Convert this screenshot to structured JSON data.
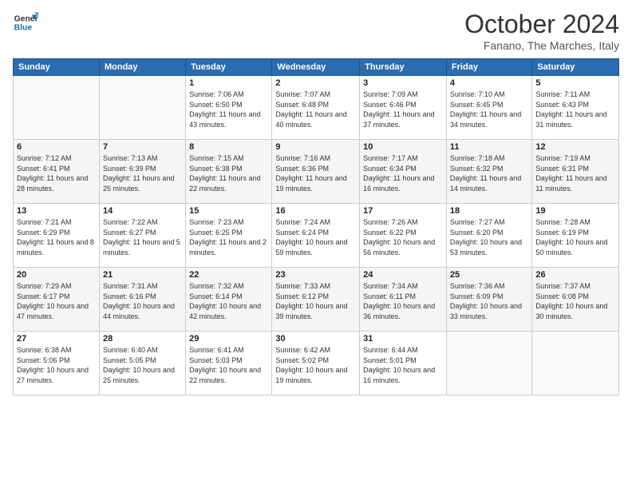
{
  "logo": {
    "line1": "General",
    "line2": "Blue"
  },
  "title": "October 2024",
  "subtitle": "Fanano, The Marches, Italy",
  "headers": [
    "Sunday",
    "Monday",
    "Tuesday",
    "Wednesday",
    "Thursday",
    "Friday",
    "Saturday"
  ],
  "weeks": [
    [
      {
        "day": "",
        "info": ""
      },
      {
        "day": "",
        "info": ""
      },
      {
        "day": "1",
        "info": "Sunrise: 7:06 AM\nSunset: 6:50 PM\nDaylight: 11 hours and 43 minutes."
      },
      {
        "day": "2",
        "info": "Sunrise: 7:07 AM\nSunset: 6:48 PM\nDaylight: 11 hours and 40 minutes."
      },
      {
        "day": "3",
        "info": "Sunrise: 7:09 AM\nSunset: 6:46 PM\nDaylight: 11 hours and 37 minutes."
      },
      {
        "day": "4",
        "info": "Sunrise: 7:10 AM\nSunset: 6:45 PM\nDaylight: 11 hours and 34 minutes."
      },
      {
        "day": "5",
        "info": "Sunrise: 7:11 AM\nSunset: 6:43 PM\nDaylight: 11 hours and 31 minutes."
      }
    ],
    [
      {
        "day": "6",
        "info": "Sunrise: 7:12 AM\nSunset: 6:41 PM\nDaylight: 11 hours and 28 minutes."
      },
      {
        "day": "7",
        "info": "Sunrise: 7:13 AM\nSunset: 6:39 PM\nDaylight: 11 hours and 25 minutes."
      },
      {
        "day": "8",
        "info": "Sunrise: 7:15 AM\nSunset: 6:38 PM\nDaylight: 11 hours and 22 minutes."
      },
      {
        "day": "9",
        "info": "Sunrise: 7:16 AM\nSunset: 6:36 PM\nDaylight: 11 hours and 19 minutes."
      },
      {
        "day": "10",
        "info": "Sunrise: 7:17 AM\nSunset: 6:34 PM\nDaylight: 11 hours and 16 minutes."
      },
      {
        "day": "11",
        "info": "Sunrise: 7:18 AM\nSunset: 6:32 PM\nDaylight: 11 hours and 14 minutes."
      },
      {
        "day": "12",
        "info": "Sunrise: 7:19 AM\nSunset: 6:31 PM\nDaylight: 11 hours and 11 minutes."
      }
    ],
    [
      {
        "day": "13",
        "info": "Sunrise: 7:21 AM\nSunset: 6:29 PM\nDaylight: 11 hours and 8 minutes."
      },
      {
        "day": "14",
        "info": "Sunrise: 7:22 AM\nSunset: 6:27 PM\nDaylight: 11 hours and 5 minutes."
      },
      {
        "day": "15",
        "info": "Sunrise: 7:23 AM\nSunset: 6:25 PM\nDaylight: 11 hours and 2 minutes."
      },
      {
        "day": "16",
        "info": "Sunrise: 7:24 AM\nSunset: 6:24 PM\nDaylight: 10 hours and 59 minutes."
      },
      {
        "day": "17",
        "info": "Sunrise: 7:26 AM\nSunset: 6:22 PM\nDaylight: 10 hours and 56 minutes."
      },
      {
        "day": "18",
        "info": "Sunrise: 7:27 AM\nSunset: 6:20 PM\nDaylight: 10 hours and 53 minutes."
      },
      {
        "day": "19",
        "info": "Sunrise: 7:28 AM\nSunset: 6:19 PM\nDaylight: 10 hours and 50 minutes."
      }
    ],
    [
      {
        "day": "20",
        "info": "Sunrise: 7:29 AM\nSunset: 6:17 PM\nDaylight: 10 hours and 47 minutes."
      },
      {
        "day": "21",
        "info": "Sunrise: 7:31 AM\nSunset: 6:16 PM\nDaylight: 10 hours and 44 minutes."
      },
      {
        "day": "22",
        "info": "Sunrise: 7:32 AM\nSunset: 6:14 PM\nDaylight: 10 hours and 42 minutes."
      },
      {
        "day": "23",
        "info": "Sunrise: 7:33 AM\nSunset: 6:12 PM\nDaylight: 10 hours and 39 minutes."
      },
      {
        "day": "24",
        "info": "Sunrise: 7:34 AM\nSunset: 6:11 PM\nDaylight: 10 hours and 36 minutes."
      },
      {
        "day": "25",
        "info": "Sunrise: 7:36 AM\nSunset: 6:09 PM\nDaylight: 10 hours and 33 minutes."
      },
      {
        "day": "26",
        "info": "Sunrise: 7:37 AM\nSunset: 6:08 PM\nDaylight: 10 hours and 30 minutes."
      }
    ],
    [
      {
        "day": "27",
        "info": "Sunrise: 6:38 AM\nSunset: 5:06 PM\nDaylight: 10 hours and 27 minutes."
      },
      {
        "day": "28",
        "info": "Sunrise: 6:40 AM\nSunset: 5:05 PM\nDaylight: 10 hours and 25 minutes."
      },
      {
        "day": "29",
        "info": "Sunrise: 6:41 AM\nSunset: 5:03 PM\nDaylight: 10 hours and 22 minutes."
      },
      {
        "day": "30",
        "info": "Sunrise: 6:42 AM\nSunset: 5:02 PM\nDaylight: 10 hours and 19 minutes."
      },
      {
        "day": "31",
        "info": "Sunrise: 6:44 AM\nSunset: 5:01 PM\nDaylight: 10 hours and 16 minutes."
      },
      {
        "day": "",
        "info": ""
      },
      {
        "day": "",
        "info": ""
      }
    ]
  ]
}
